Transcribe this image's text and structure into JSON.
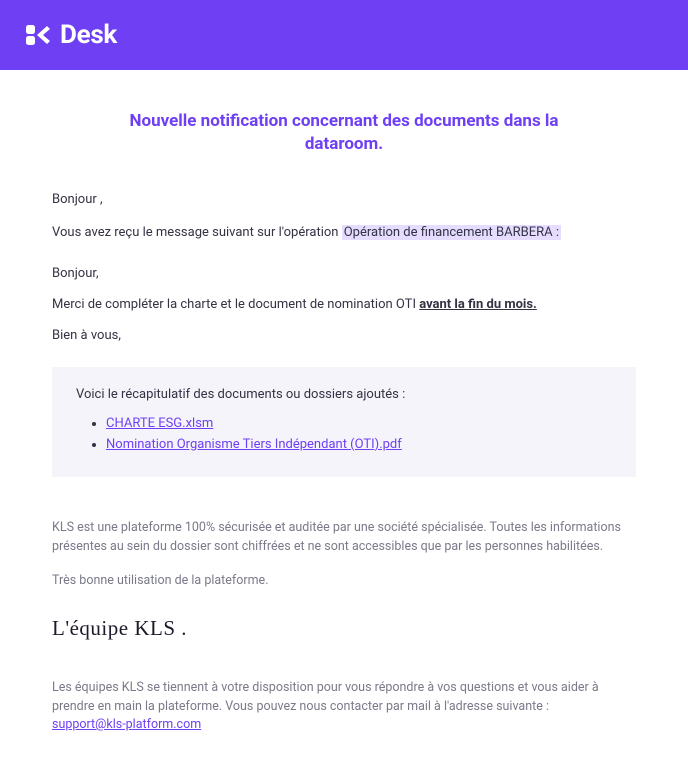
{
  "brand": {
    "name": "Desk"
  },
  "title": "Nouvelle notification concernant des documents dans la dataroom.",
  "greeting": "Bonjour ,",
  "intro": {
    "prefix": "Vous avez reçu le message suivant sur l'opération ",
    "operation": "Opération de financement BARBERA :"
  },
  "message": {
    "hello": "Bonjour,",
    "body_prefix": "Merci de compléter la charte et le document de nomination OTI ",
    "body_emphasis": "avant la fin du mois.",
    "signoff": "Bien à vous,"
  },
  "recap": {
    "title": "Voici le récapitulatif des documents ou dossiers ajoutés :",
    "documents": [
      "CHARTE ESG.xlsm",
      "Nomination Organisme Tiers Indépendant (OTI).pdf"
    ]
  },
  "security_note": "KLS est une plateforme 100% sécurisée et auditée par une société spécialisée. Toutes les informations présentes au sein du dossier sont chiffrées et ne sont accessibles que par les personnes habilitées.",
  "goodbye": "Très bonne utilisation de la plateforme.",
  "signature": "L'équipe KLS .",
  "footer": {
    "help_text": "Les équipes KLS se tiennent à votre disposition pour vous répondre à vos questions et vous aider à prendre en main la plateforme. Vous pouvez nous contacter par mail à l'adresse suivante :",
    "support_email": "support@kls-platform.com"
  }
}
